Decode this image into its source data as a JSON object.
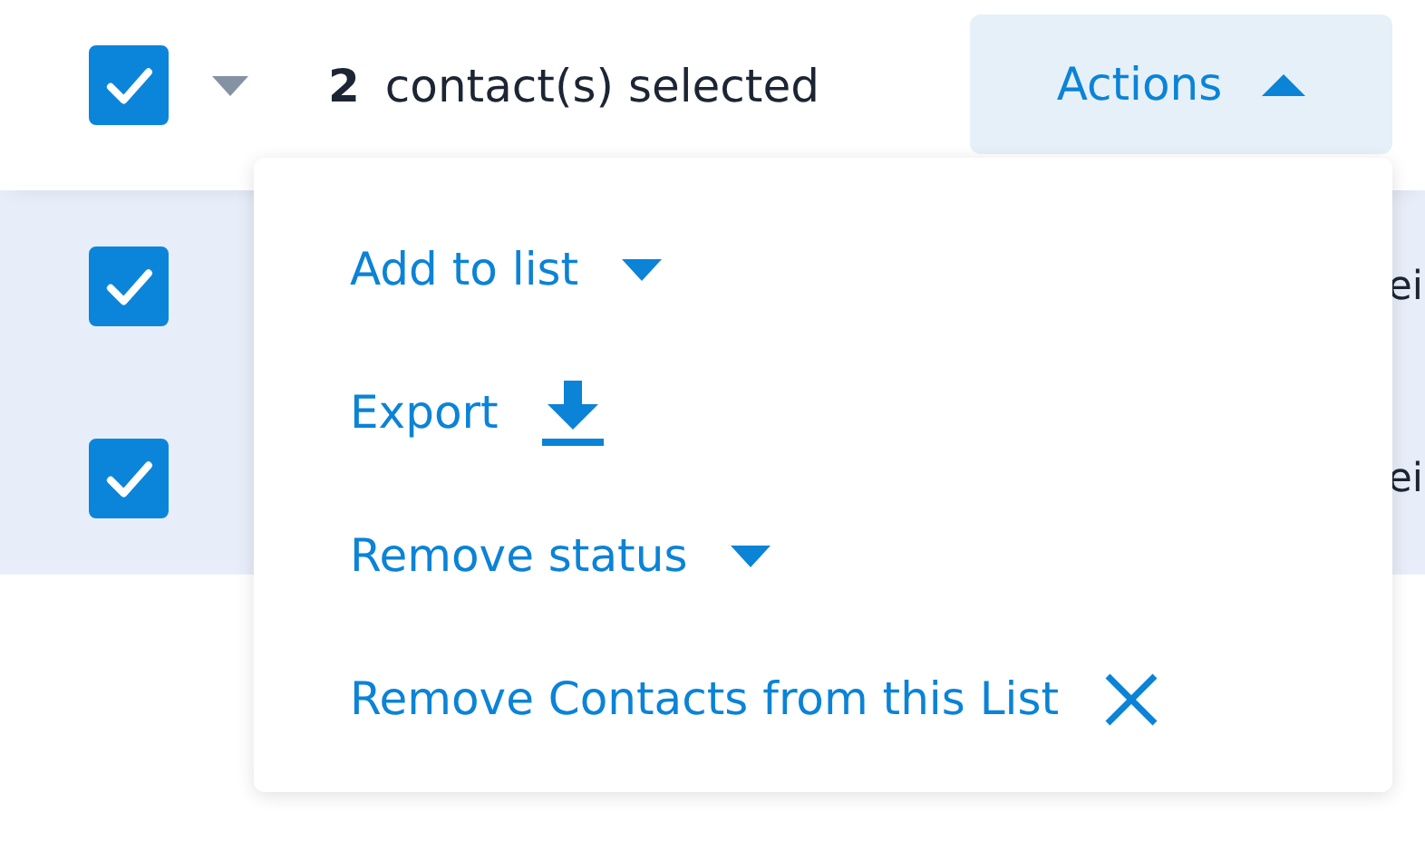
{
  "header": {
    "select_all": {
      "checked": true
    },
    "count": "2",
    "count_label": "contact(s) selected",
    "actions_button": {
      "label": "Actions",
      "expanded": true
    }
  },
  "rows": [
    {
      "checked": true,
      "text": "ei"
    },
    {
      "checked": true,
      "text": "ei"
    }
  ],
  "menu": {
    "items": [
      {
        "label": "Add to list",
        "kind": "dropdown"
      },
      {
        "label": "Export",
        "kind": "download"
      },
      {
        "label": "Remove status",
        "kind": "dropdown"
      },
      {
        "label": "Remove Contacts from this List",
        "kind": "remove"
      }
    ]
  }
}
